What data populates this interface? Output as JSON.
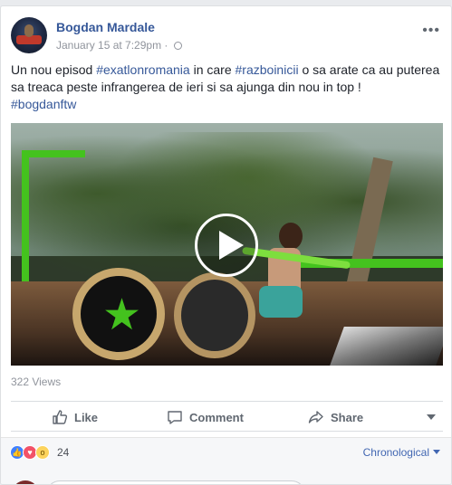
{
  "post": {
    "author": "Bogdan Mardale",
    "timestamp": "January 15 at 7:29pm",
    "separator": "·",
    "more_label": "•••",
    "text": {
      "before": "Un nou episod ",
      "tag1": "#exatlonromania",
      "middle1": " in care ",
      "tag2": "#razboinicii",
      "middle2": " o sa arate ca au puterea sa treaca peste infrangerea de ieri si sa ajunga din nou in top !",
      "tag3": "#bogdanftw"
    },
    "views": "322 Views"
  },
  "actions": {
    "like": "Like",
    "comment": "Comment",
    "share": "Share"
  },
  "reactions": {
    "count": "24",
    "sort_label": "Chronological",
    "types": [
      "like-icon",
      "love-icon",
      "wow-icon"
    ]
  },
  "colors": {
    "link": "#365899",
    "muted": "#90949c",
    "accent_green": "#44c21e"
  }
}
